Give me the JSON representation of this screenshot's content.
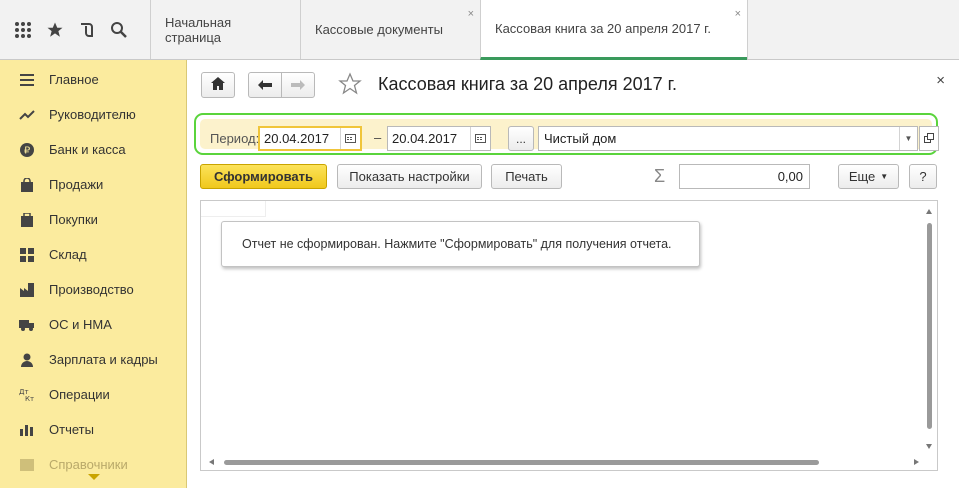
{
  "tabs": [
    {
      "label": "Начальная страница"
    },
    {
      "label": "Кассовые документы",
      "close": "×"
    },
    {
      "label": "Кассовая книга за 20 апреля 2017 г.",
      "close": "×"
    }
  ],
  "top_icons": [
    "apps-grid-icon",
    "star-icon",
    "history-icon",
    "search-icon"
  ],
  "sidebar": {
    "items": [
      {
        "label": "Главное",
        "icon": "menu-lines-icon"
      },
      {
        "label": "Руководителю",
        "icon": "trend-icon"
      },
      {
        "label": "Банк и касса",
        "icon": "ruble-coin-icon"
      },
      {
        "label": "Продажи",
        "icon": "shopping-bag-icon"
      },
      {
        "label": "Покупки",
        "icon": "cart-icon"
      },
      {
        "label": "Склад",
        "icon": "warehouse-icon"
      },
      {
        "label": "Производство",
        "icon": "factory-icon"
      },
      {
        "label": "ОС и НМА",
        "icon": "truck-icon"
      },
      {
        "label": "Зарплата и кадры",
        "icon": "people-icon"
      },
      {
        "label": "Операции",
        "icon": "dt-kt-icon"
      },
      {
        "label": "Отчеты",
        "icon": "bar-chart-icon"
      },
      {
        "label": "Справочники",
        "icon": "book-icon"
      }
    ]
  },
  "page": {
    "title": "Кассовая книга за 20 апреля 2017 г.",
    "close": "×"
  },
  "filter": {
    "period_label": "Период:",
    "date_from": "20.04.2017",
    "dash": "–",
    "date_to": "20.04.2017",
    "dots": "...",
    "organization": "Чистый дом"
  },
  "toolbar": {
    "generate": "Сформировать",
    "show_settings": "Показать настройки",
    "print": "Печать",
    "sigma": "Σ",
    "sum": "0,00",
    "more": "Еще",
    "help": "?"
  },
  "report": {
    "notice": "Отчет не сформирован. Нажмите \"Сформировать\" для получения отчета."
  },
  "colors": {
    "sidebar_bg": "#fbeb9e",
    "accent_green": "#5ad43c",
    "primary_button": "#f0c81c",
    "active_tab_underline": "#3a9a5c"
  }
}
